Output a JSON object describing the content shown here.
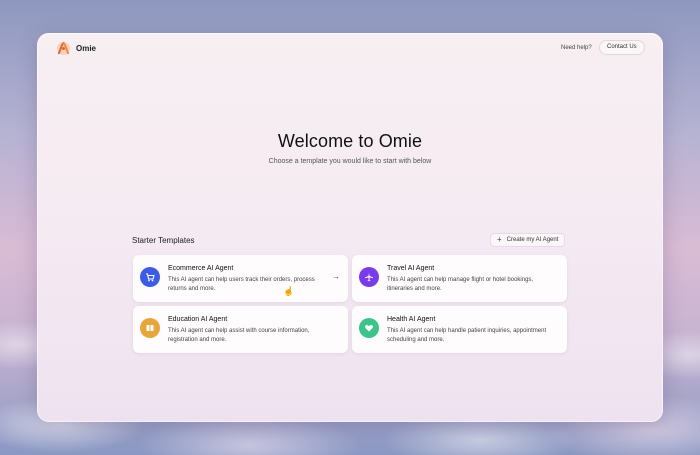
{
  "brand": {
    "name": "Omie",
    "logo_icon": "omie-logo-icon"
  },
  "header": {
    "help_label": "Need help?",
    "contact_label": "Contact Us"
  },
  "hero": {
    "title": "Welcome to Omie",
    "subtitle": "Choose a template you would like to start with below"
  },
  "templates": {
    "section_title": "Starter Templates",
    "create_label": "Create my AI Agent",
    "cards": [
      {
        "title": "Ecommerce AI Agent",
        "description": "This AI agent can help users track their orders, process returns and more.",
        "icon": "cart-icon",
        "color": "#3d5ce5"
      },
      {
        "title": "Travel AI Agent",
        "description": "This AI agent can help manage flight or hotel bookings, itineraries and more.",
        "icon": "airplane-icon",
        "color": "#7a3ce8"
      },
      {
        "title": "Education AI Agent",
        "description": "This AI agent can help assist with course information, registration and more.",
        "icon": "book-icon",
        "color": "#e8a53c"
      },
      {
        "title": "Health AI Agent",
        "description": "This AI agent can help handle patient inquiries, appointment scheduling and more.",
        "icon": "heart-icon",
        "color": "#3cc48a"
      }
    ]
  }
}
